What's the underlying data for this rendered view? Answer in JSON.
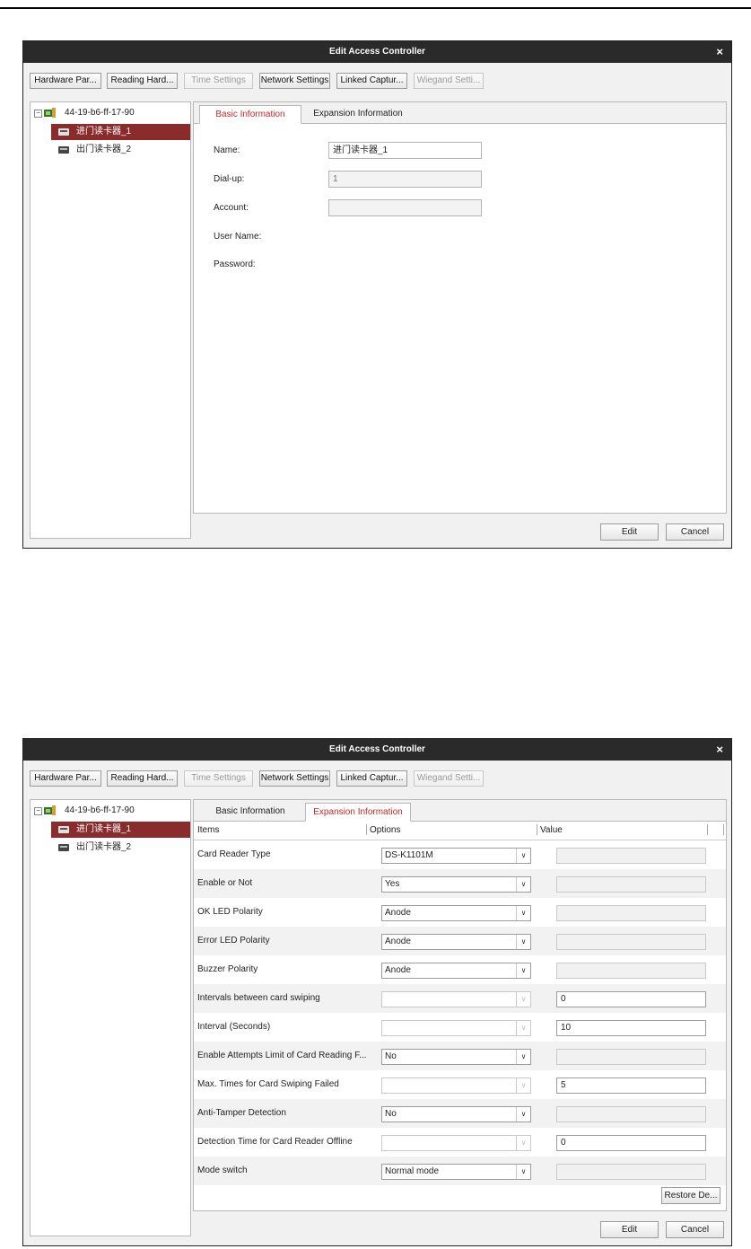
{
  "dialogs": [
    {
      "title": "Edit Access Controller",
      "close_label": "×",
      "toolbar": [
        {
          "label": "Hardware Par...",
          "enabled": true
        },
        {
          "label": "Reading Hard...",
          "enabled": true
        },
        {
          "label": "Time Settings",
          "enabled": false
        },
        {
          "label": "Network Settings",
          "enabled": true
        },
        {
          "label": "Linked Captur...",
          "enabled": true
        },
        {
          "label": "Wiegand Setti...",
          "enabled": false
        }
      ],
      "tree": {
        "expander": "−",
        "root": "44-19-b6-ff-17-90",
        "children": [
          "进门读卡器_1",
          "出门读卡器_2"
        ],
        "selected_index": 0
      },
      "tabs": [
        "Basic Information",
        "Expansion Information"
      ],
      "active_tab": 0,
      "basic": {
        "name_label": "Name:",
        "name_value": "进门读卡器_1",
        "dialup_label": "Dial-up:",
        "dialup_value": "1",
        "account_label": "Account:",
        "account_value": "",
        "username_label": "User Name:",
        "password_label": "Password:"
      },
      "footer": {
        "edit": "Edit",
        "cancel": "Cancel"
      }
    },
    {
      "title": "Edit Access Controller",
      "close_label": "×",
      "toolbar": [
        {
          "label": "Hardware Par...",
          "enabled": true
        },
        {
          "label": "Reading Hard...",
          "enabled": true
        },
        {
          "label": "Time Settings",
          "enabled": false
        },
        {
          "label": "Network Settings",
          "enabled": true
        },
        {
          "label": "Linked Captur...",
          "enabled": true
        },
        {
          "label": "Wiegand Setti...",
          "enabled": false
        }
      ],
      "tree": {
        "expander": "−",
        "root": "44-19-b6-ff-17-90",
        "children": [
          "进门读卡器_1",
          "出门读卡器_2"
        ],
        "selected_index": 0
      },
      "tabs": [
        "Basic Information",
        "Expansion Information"
      ],
      "active_tab": 1,
      "expansion": {
        "columns": [
          "Items",
          "Options",
          "Value"
        ],
        "rows": [
          {
            "label": "Card Reader Type",
            "option": "DS-K1101M",
            "option_enabled": true,
            "value": "",
            "value_enabled": false
          },
          {
            "label": "Enable or Not",
            "option": "Yes",
            "option_enabled": true,
            "value": "",
            "value_enabled": false
          },
          {
            "label": "OK LED Polarity",
            "option": "Anode",
            "option_enabled": true,
            "value": "",
            "value_enabled": false
          },
          {
            "label": "Error LED Polarity",
            "option": "Anode",
            "option_enabled": true,
            "value": "",
            "value_enabled": false
          },
          {
            "label": "Buzzer Polarity",
            "option": "Anode",
            "option_enabled": true,
            "value": "",
            "value_enabled": false
          },
          {
            "label": "Intervals between card swiping",
            "option": "",
            "option_enabled": false,
            "value": "0",
            "value_enabled": true
          },
          {
            "label": "Interval (Seconds)",
            "option": "",
            "option_enabled": false,
            "value": "10",
            "value_enabled": true
          },
          {
            "label": "Enable Attempts Limit of Card Reading F...",
            "option": "No",
            "option_enabled": true,
            "value": "",
            "value_enabled": false
          },
          {
            "label": "Max. Times for Card Swiping Failed",
            "option": "",
            "option_enabled": false,
            "value": "5",
            "value_enabled": true
          },
          {
            "label": "Anti-Tamper Detection",
            "option": "No",
            "option_enabled": true,
            "value": "",
            "value_enabled": false
          },
          {
            "label": "Detection Time for Card Reader Offline",
            "option": "",
            "option_enabled": false,
            "value": "0",
            "value_enabled": true
          },
          {
            "label": "Mode switch",
            "option": "Normal mode",
            "option_enabled": true,
            "value": "",
            "value_enabled": false
          }
        ],
        "restore_label": "Restore De..."
      },
      "footer": {
        "edit": "Edit",
        "cancel": "Cancel"
      }
    }
  ],
  "colors": {
    "titlebar": "#2a2a2a",
    "selected_row": "#8a2c2c",
    "active_tab_text": "#c62828",
    "dialog_bg": "#f1f1f1"
  },
  "icons": {
    "close": "close-icon",
    "tree_expand": "collapse-icon",
    "controller": "access-controller-icon",
    "reader": "card-reader-icon",
    "dropdown": "chevron-down-icon"
  }
}
